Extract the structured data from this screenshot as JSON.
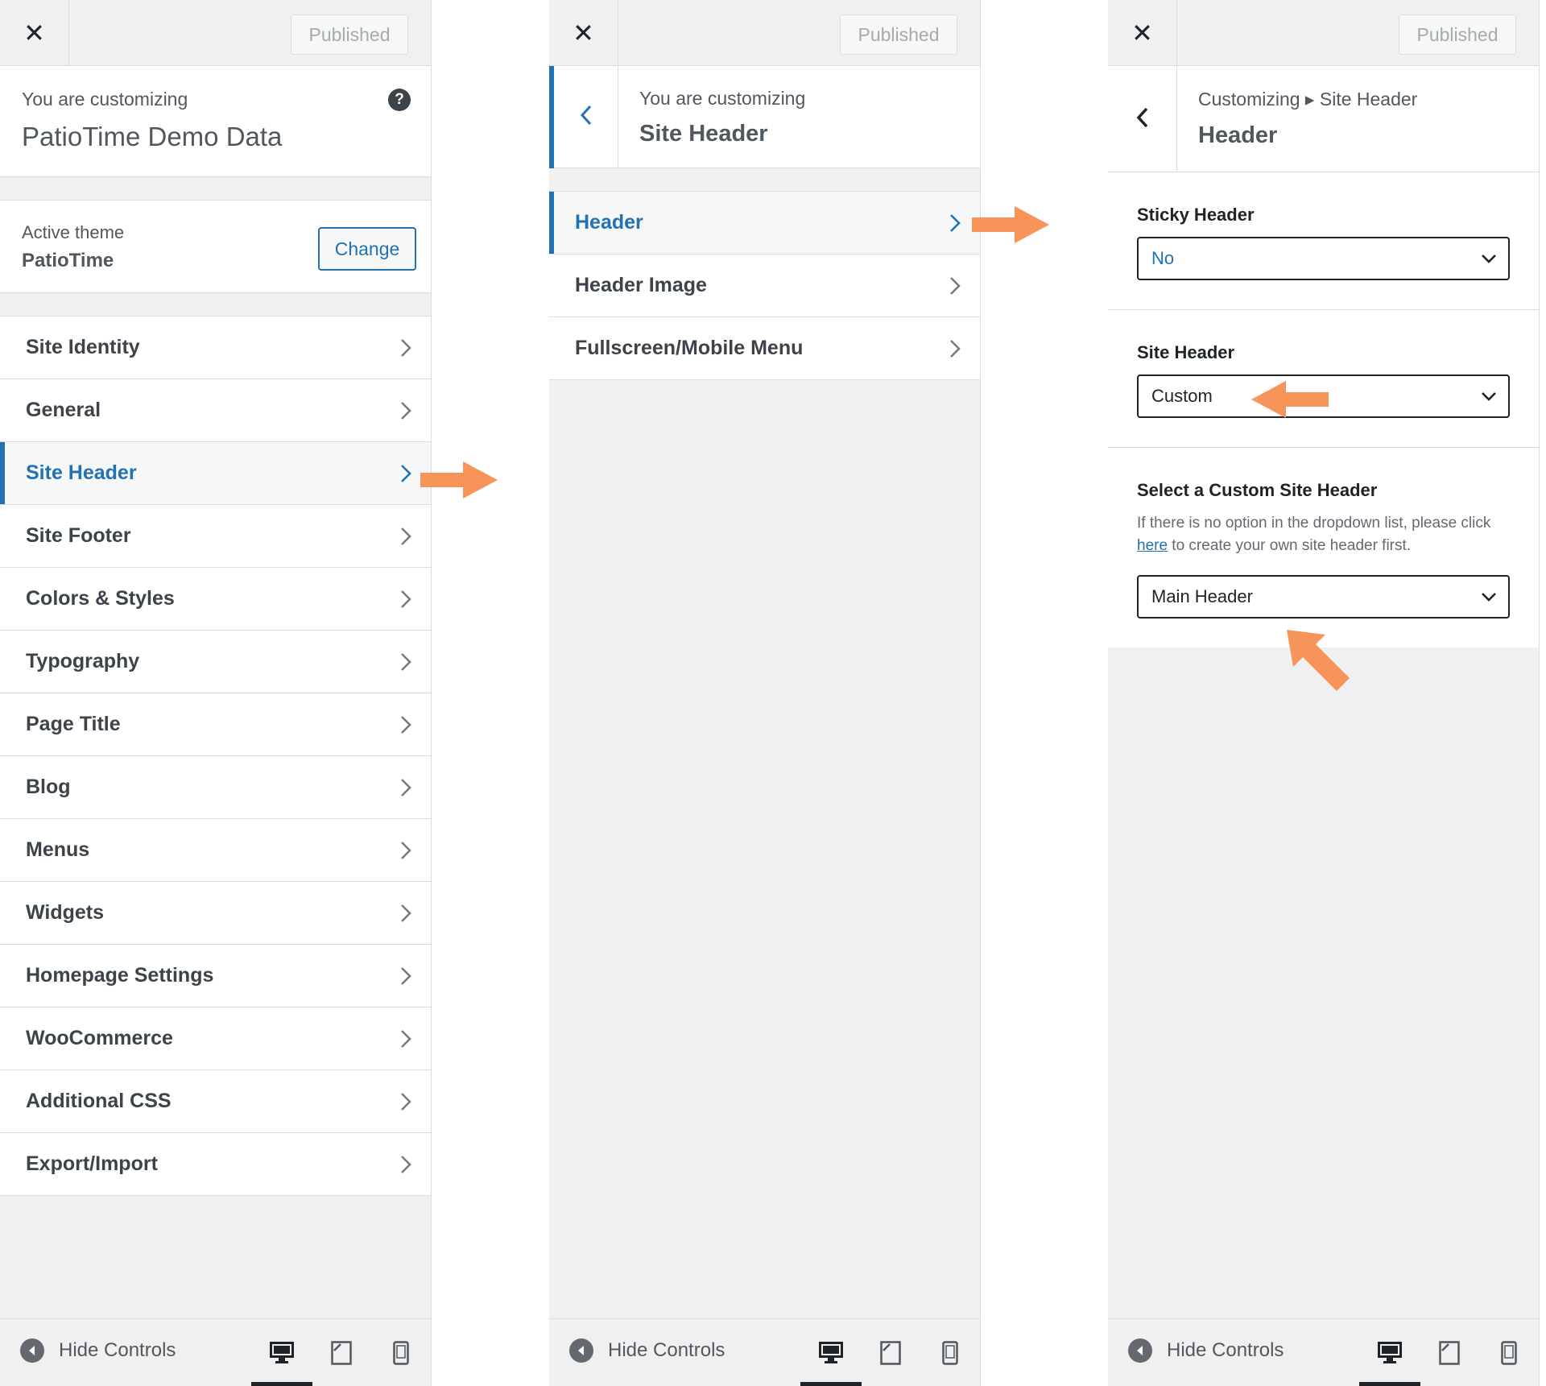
{
  "colors": {
    "accent": "#2271b1",
    "orange": "#f7945a",
    "text": "#1d2327",
    "muted": "#50575e"
  },
  "common": {
    "published_label": "Published",
    "hide_controls_label": "Hide Controls"
  },
  "panel1": {
    "customizing_label": "You are customizing",
    "site_name": "PatioTime Demo Data",
    "active_theme_label": "Active theme",
    "theme_name": "PatioTime",
    "change_label": "Change",
    "menu": [
      {
        "label": "Site Identity"
      },
      {
        "label": "General"
      },
      {
        "label": "Site Header",
        "active": true
      },
      {
        "label": "Site Footer"
      },
      {
        "label": "Colors & Styles"
      },
      {
        "label": "Typography"
      },
      {
        "label": "Page Title"
      },
      {
        "label": "Blog"
      },
      {
        "label": "Menus"
      },
      {
        "label": "Widgets"
      },
      {
        "label": "Homepage Settings"
      },
      {
        "label": "WooCommerce"
      },
      {
        "label": "Additional CSS"
      },
      {
        "label": "Export/Import"
      }
    ]
  },
  "panel2": {
    "customizing_label": "You are customizing",
    "section_title": "Site Header",
    "menu": [
      {
        "label": "Header",
        "active": true
      },
      {
        "label": "Header Image"
      },
      {
        "label": "Fullscreen/Mobile Menu"
      }
    ]
  },
  "panel3": {
    "breadcrumb": "Customizing ▸ Site Header",
    "section_title": "Header",
    "sticky_header": {
      "label": "Sticky Header",
      "value": "No"
    },
    "site_header": {
      "label": "Site Header",
      "value": "Custom"
    },
    "custom_site_header": {
      "label": "Select a Custom Site Header",
      "desc_before": "If there is no option in the dropdown list, please click ",
      "desc_link": "here",
      "desc_after": " to create your own site header first.",
      "value": "Main Header"
    }
  }
}
